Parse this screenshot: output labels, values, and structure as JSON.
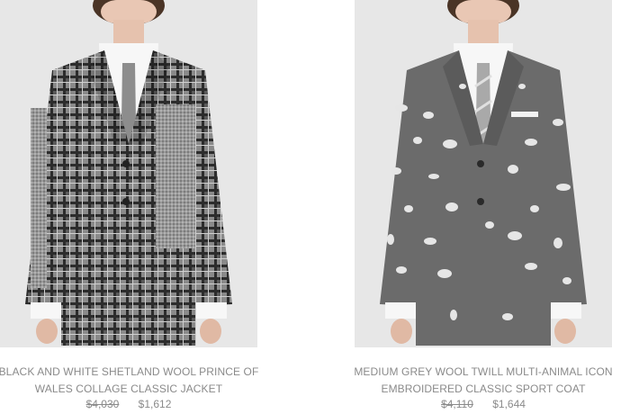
{
  "products": [
    {
      "title": "BLACK AND WHITE SHETLAND WOOL PRINCE OF WALES COLLAGE CLASSIC JACKET",
      "original_price": "$4,030",
      "sale_price": "$1,612"
    },
    {
      "title": "MEDIUM GREY WOOL TWILL MULTI-ANIMAL ICON EMBROIDERED CLASSIC SPORT COAT",
      "original_price": "$4,110",
      "sale_price": "$1,644"
    }
  ],
  "colors": {
    "photo_background": "#e7e7e7",
    "text": "#8a8a8a",
    "jacket_1": "#6e6e6e",
    "jacket_2": "#6b6b6b"
  }
}
